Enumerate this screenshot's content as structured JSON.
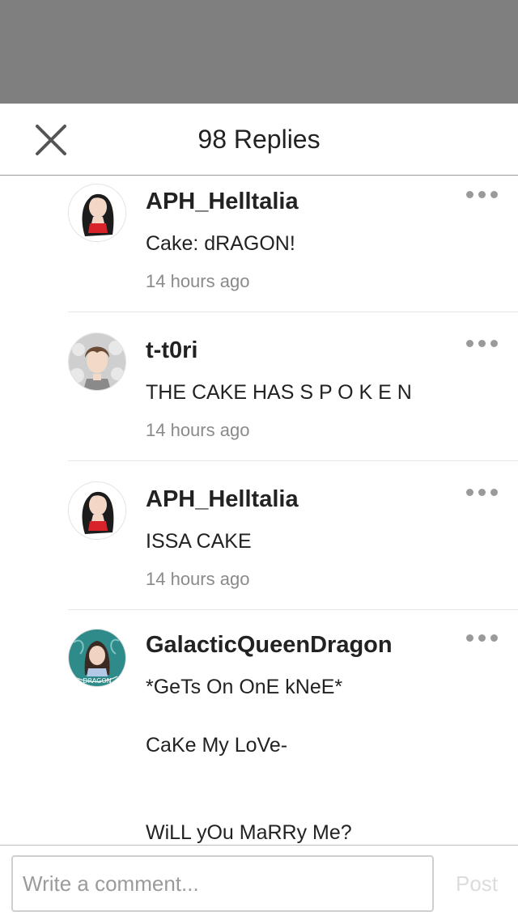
{
  "header": {
    "title": "98 Replies",
    "close_icon": "close-icon"
  },
  "replies": [
    {
      "username": "APH_Helltalia",
      "lines": [
        "Cake: dRAGON!"
      ],
      "time": "14 hours ago",
      "avatar": "avatar-black-hair-red-top"
    },
    {
      "username": "t-t0ri",
      "lines": [
        "THE CAKE HAS  S P O K E N"
      ],
      "time": "14 hours ago",
      "avatar": "avatar-brown-hair-boy"
    },
    {
      "username": "APH_Helltalia",
      "lines": [
        "ISSA CAKE"
      ],
      "time": "14 hours ago",
      "avatar": "avatar-black-hair-red-top"
    },
    {
      "username": "GalacticQueenDragon",
      "lines": [
        "*GeTs On OnE kNeE*",
        "CaKe My LoVe-",
        "WiLL yOu MaRRy Me?"
      ],
      "avatar": "avatar-teal-dragon",
      "avatar_text": "DRAGON"
    }
  ],
  "footer": {
    "placeholder": "Write a comment...",
    "post_label": "Post"
  },
  "colors": {
    "overlay": "#7f7f7f",
    "divider": "#9a9a9a",
    "text": "#222222",
    "muted": "#8a8a8a",
    "post_disabled": "#dcdcdc"
  }
}
